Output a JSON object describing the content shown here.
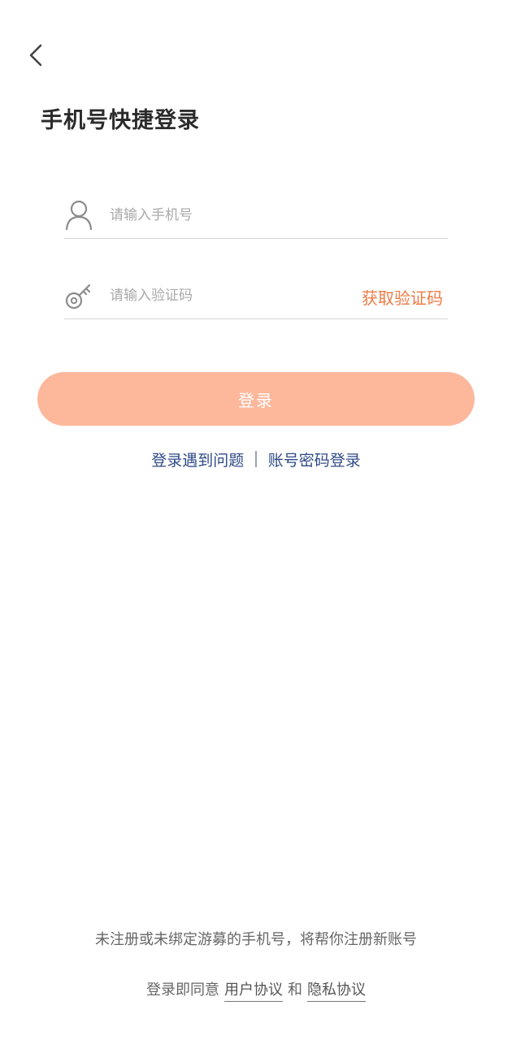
{
  "header": {
    "back_icon": "chevron-left-icon",
    "title": "手机号快捷登录"
  },
  "form": {
    "phone": {
      "icon": "user-icon",
      "placeholder": "请输入手机号",
      "value": ""
    },
    "code": {
      "icon": "key-icon",
      "placeholder": "请输入验证码",
      "value": "",
      "get_code_label": "获取验证码"
    },
    "login_label": "登录"
  },
  "links": {
    "trouble_label": "登录遇到问题",
    "password_login_label": "账号密码登录"
  },
  "footer": {
    "notice": "未注册或未绑定游募的手机号，将帮你注册新账号",
    "agree_prefix": "登录即同意",
    "user_agreement_label": "用户协议",
    "and_label": "和",
    "privacy_label": "隐私协议"
  },
  "colors": {
    "accent": "#ee7a45",
    "login_button_bg": "#fdb79b",
    "link": "#2f4a86",
    "title": "#2b2b2b"
  }
}
